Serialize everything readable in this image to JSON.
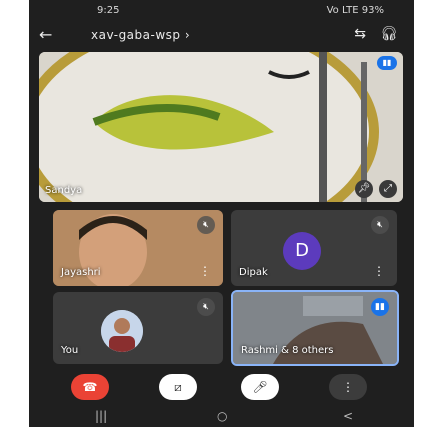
{
  "status": {
    "time": "9:25",
    "right": "Vo LTE 93%"
  },
  "topbar": {
    "title": "xav-gaba-wsp",
    "title_suffix": "›"
  },
  "main": {
    "name": "Sandya"
  },
  "tiles": [
    {
      "name": "Jayashri"
    },
    {
      "name": "Dipak",
      "initial": "D"
    },
    {
      "name": "You"
    },
    {
      "name": "Rashmi & 8 others"
    }
  ],
  "controls": {
    "end": "☎",
    "cam": "⧄",
    "mic": "🎤︎",
    "more": "⋮"
  },
  "icons": {
    "back": "←",
    "swap": "⇆",
    "audio": "🎧︎",
    "pin": "📌︎",
    "expand": "⤢",
    "mute": "🔇︎",
    "more": "⋮",
    "speaking": "▮▮"
  },
  "nav": {
    "recent": "|||",
    "home": "○",
    "back": "<"
  }
}
